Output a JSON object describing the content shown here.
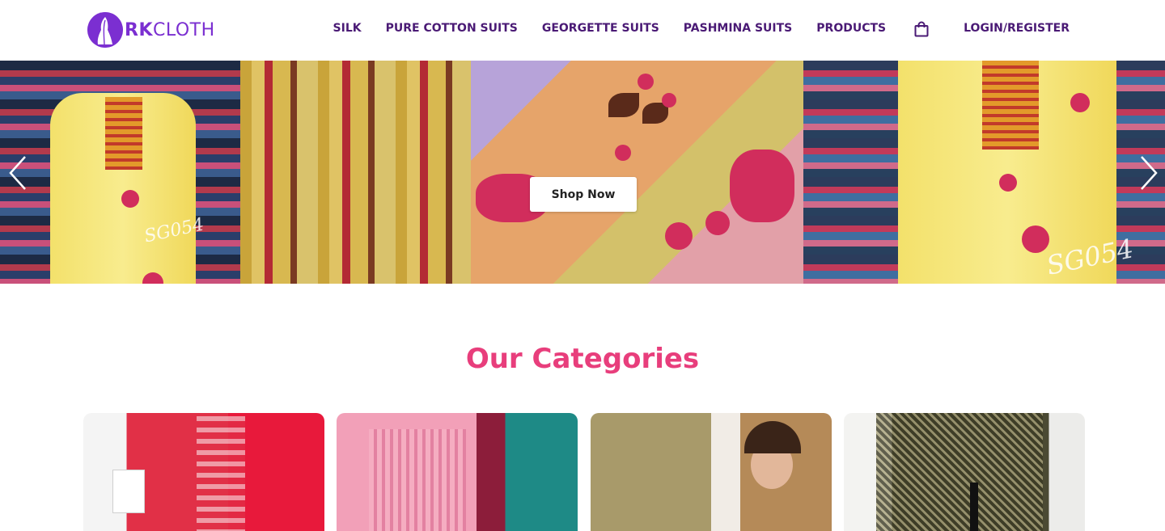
{
  "brand": {
    "logo_prefix": "RK",
    "logo_suffix": "CLOTH",
    "accent_color": "#7b2fd1",
    "nav_color": "#4a1a75"
  },
  "nav": {
    "items": [
      {
        "label": "SILK"
      },
      {
        "label": "PURE COTTON SUITS"
      },
      {
        "label": "GEORGETTE SUITS"
      },
      {
        "label": "PASHMINA SUITS"
      },
      {
        "label": "PRODUCTS"
      }
    ],
    "cart_icon": "shopping-bag-icon",
    "login_label": "LOGIN/REGISTER"
  },
  "hero": {
    "cta_label": "Shop Now",
    "prev_icon": "chevron-left-icon",
    "next_icon": "chevron-right-icon",
    "stamp_left": "SG054",
    "stamp_right": "SG054"
  },
  "categories": {
    "title": "Our Categories",
    "title_color": "#e83e7c"
  }
}
